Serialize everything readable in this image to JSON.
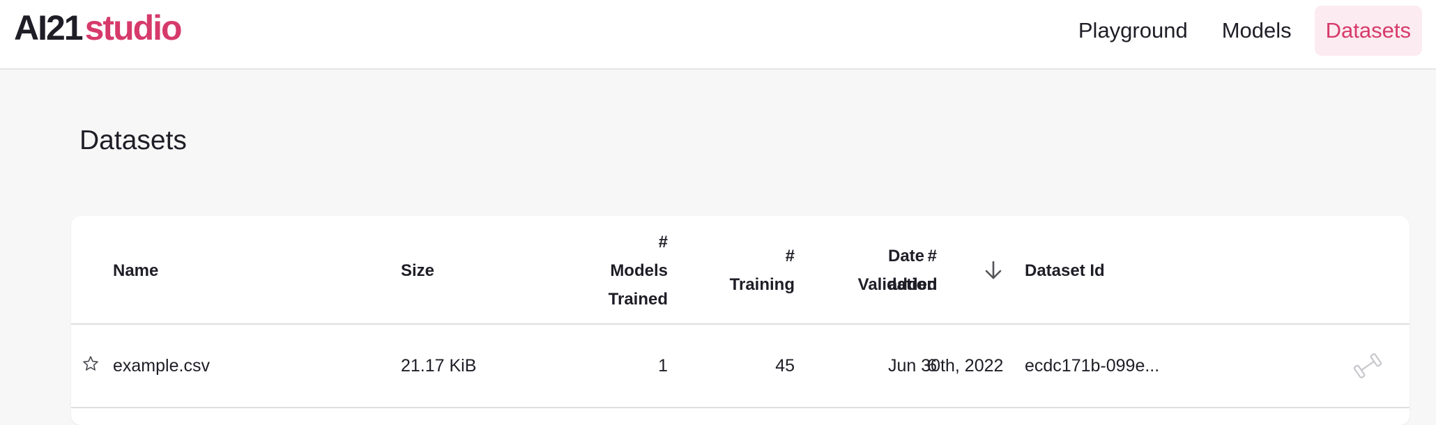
{
  "header": {
    "logo_ai": "AI21",
    "logo_studio": "studio",
    "nav": [
      {
        "label": "Playground"
      },
      {
        "label": "Models"
      },
      {
        "label": "Datasets"
      }
    ]
  },
  "page": {
    "title": "Datasets"
  },
  "table": {
    "columns": {
      "name": "Name",
      "size": "Size",
      "models_hash": "#",
      "models_l1": "Models",
      "models_l2": "Trained",
      "training_hash": "#",
      "training_l1": "Training",
      "validation_hash": "#",
      "validation_l1": "Validation",
      "date_l1": "Date",
      "date_l2": "added",
      "dataset_id": "Dataset Id"
    },
    "rows": [
      {
        "name": "example.csv",
        "size": "21.17 KiB",
        "models_trained": "1",
        "training": "45",
        "validation": "6",
        "date_added": "Jun 30th, 2022",
        "dataset_id": "ecdc171b-099e..."
      }
    ]
  },
  "icons": {
    "sort": "arrow-down-icon",
    "favorite": "star-outline-icon",
    "train": "dumbbell-icon"
  },
  "colors": {
    "accent": "#d63a6b",
    "nav_active_bg": "#fcebf0"
  }
}
